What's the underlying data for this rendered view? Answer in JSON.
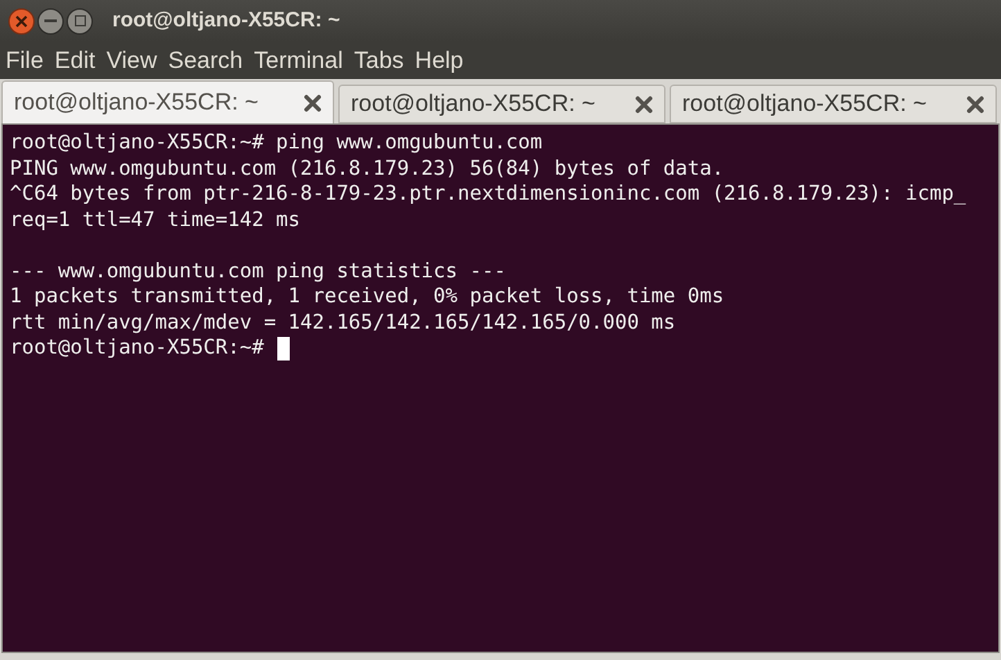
{
  "window": {
    "title": "root@oltjano-X55CR: ~"
  },
  "menu": [
    "File",
    "Edit",
    "View",
    "Search",
    "Terminal",
    "Tabs",
    "Help"
  ],
  "tabs": [
    {
      "label": "root@oltjano-X55CR: ~",
      "selected": true
    },
    {
      "label": "root@oltjano-X55CR: ~",
      "selected": false
    },
    {
      "label": "root@oltjano-X55CR: ~",
      "selected": false
    }
  ],
  "terminal": {
    "blocks": [
      [
        "root@oltjano-X55CR:~# ping www.omgubuntu.com",
        "PING www.omgubuntu.com (216.8.179.23) 56(84) bytes of data.",
        "^C64 bytes from ptr-216-8-179-23.ptr.nextdimensioninc.com (216.8.179.23): icmp_",
        "req=1 ttl=47 time=142 ms"
      ],
      [
        "--- www.omgubuntu.com ping statistics ---",
        "1 packets transmitted, 1 received, 0% packet loss, time 0ms",
        "rtt min/avg/max/mdev = 142.165/142.165/142.165/0.000 ms"
      ]
    ],
    "prompt": "root@oltjano-X55CR:~#"
  }
}
